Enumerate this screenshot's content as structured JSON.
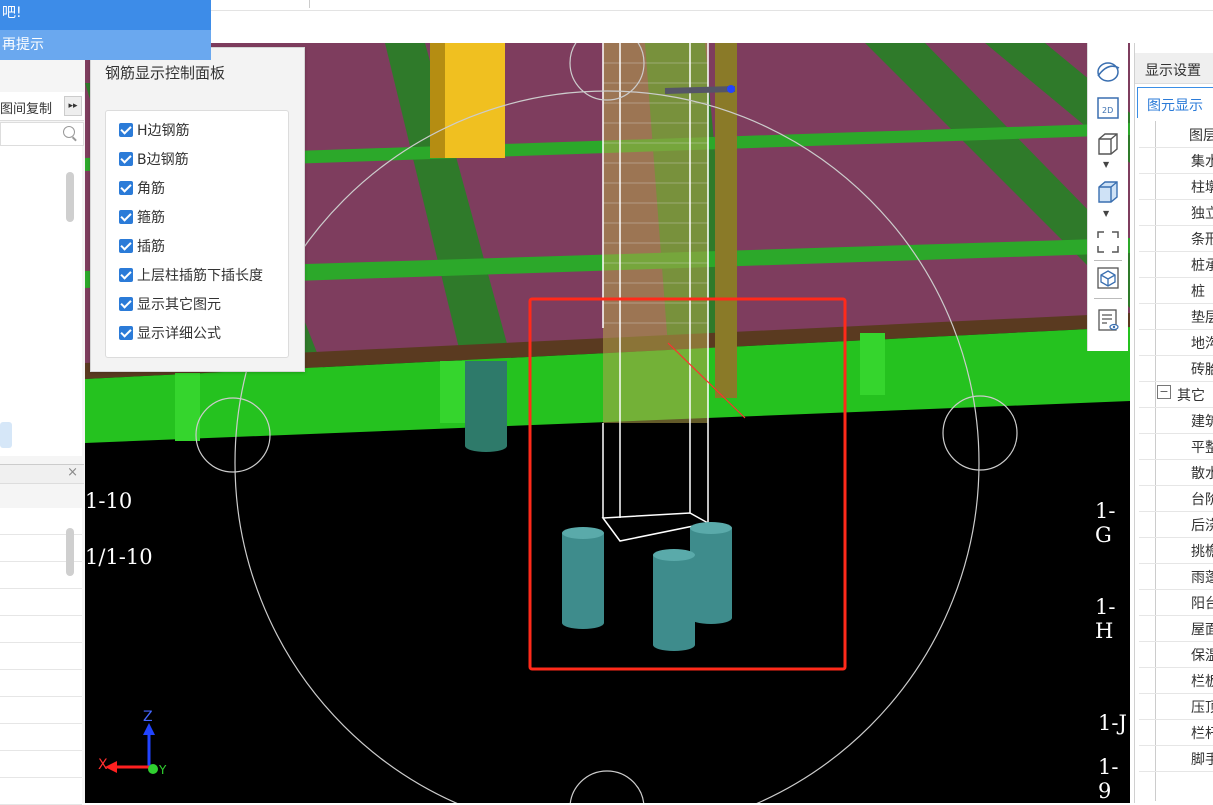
{
  "notice": {
    "line1": "吧!",
    "line2": "再提示"
  },
  "left_panel": {
    "header_label": "图间复制",
    "more_icon": "double-arrow-right-icon",
    "search_icon": "search-icon",
    "close_label": "×"
  },
  "viewport": {
    "axis_labels": [
      "1-10",
      "1/1-10",
      "1-G",
      "1-H",
      "1-J",
      "1-9"
    ],
    "triad": {
      "x": "X",
      "y": "Y",
      "z": "Z"
    },
    "colors": {
      "background": "#000000",
      "slab": "#7e3d5e",
      "beam": "#2fa02c",
      "column": "#f0c020",
      "pile": "#3e8c8c",
      "highlight": "#ff2a1a"
    }
  },
  "control_panel": {
    "title": "钢筋显示控制面板",
    "items": [
      {
        "label": "H边钢筋",
        "checked": true
      },
      {
        "label": "B边钢筋",
        "checked": true
      },
      {
        "label": "角筋",
        "checked": true
      },
      {
        "label": "箍筋",
        "checked": true
      },
      {
        "label": "插筋",
        "checked": true
      },
      {
        "label": "上层柱插筋下插长度",
        "checked": true
      },
      {
        "label": "显示其它图元",
        "checked": true
      },
      {
        "label": "显示详细公式",
        "checked": true
      }
    ]
  },
  "view_toolbar": {
    "icons": [
      "orbit-icon",
      "2d-view-icon",
      "3d-box-icon",
      "3d-box-filled-icon",
      "fit-view-icon",
      "cube-view-icon",
      "display-settings-icon"
    ],
    "label_2d": "2D"
  },
  "right_panel": {
    "title": "显示设置",
    "tab": "图元显示",
    "rows": [
      {
        "label": "图层",
        "level": 0
      },
      {
        "label": "集水",
        "level": 1
      },
      {
        "label": "柱墩",
        "level": 1
      },
      {
        "label": "独立",
        "level": 1
      },
      {
        "label": "条形",
        "level": 1
      },
      {
        "label": "桩承",
        "level": 1
      },
      {
        "label": "桩",
        "level": 1
      },
      {
        "label": "垫层",
        "level": 1
      },
      {
        "label": "地沟",
        "level": 1
      },
      {
        "label": "砖胎",
        "level": 1
      },
      {
        "label": "其它",
        "level": 0,
        "expander": "−"
      },
      {
        "label": "建筑",
        "level": 1
      },
      {
        "label": "平整",
        "level": 1
      },
      {
        "label": "散水",
        "level": 1
      },
      {
        "label": "台阶",
        "level": 1
      },
      {
        "label": "后浇",
        "level": 1
      },
      {
        "label": "挑檐",
        "level": 1
      },
      {
        "label": "雨蓬",
        "level": 1
      },
      {
        "label": "阳台",
        "level": 1
      },
      {
        "label": "屋面",
        "level": 1
      },
      {
        "label": "保温",
        "level": 1
      },
      {
        "label": "栏板",
        "level": 1
      },
      {
        "label": "压顶",
        "level": 1
      },
      {
        "label": "栏杆",
        "level": 1
      },
      {
        "label": "脚手",
        "level": 1
      }
    ]
  }
}
